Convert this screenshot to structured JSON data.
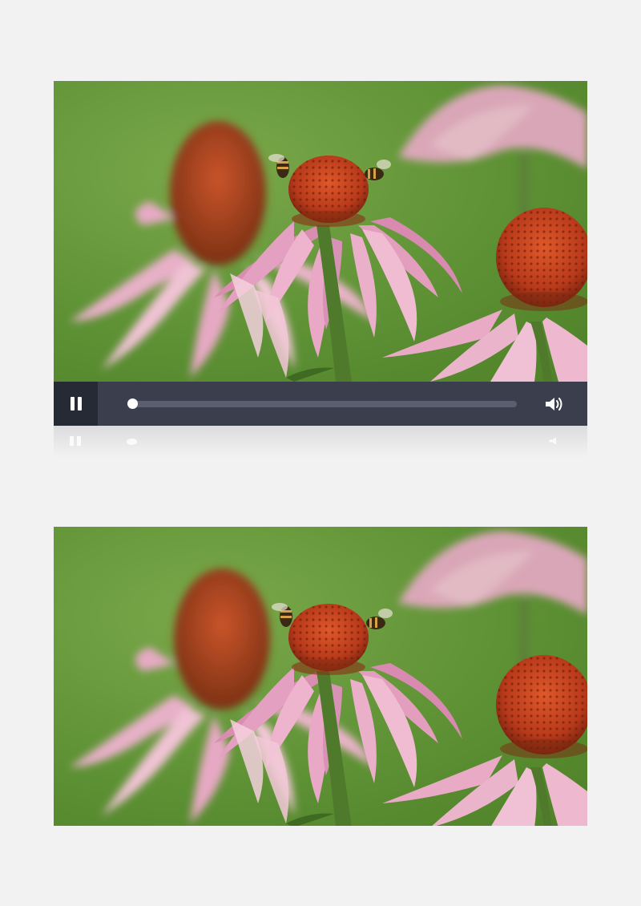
{
  "player": {
    "state_icon": "pause-icon",
    "progress": 0.0,
    "volume_icon": "volume-icon"
  },
  "colors": {
    "page_background": "#f2f2f2",
    "control_bar": "#3b3f4d",
    "pause_button_bg": "#262a34",
    "track": "#5a5e6e",
    "knob": "#ffffff",
    "meadow_green": "#5e9235",
    "petal_pink": "#e9a7c4",
    "cone_orange": "#c0431a"
  }
}
